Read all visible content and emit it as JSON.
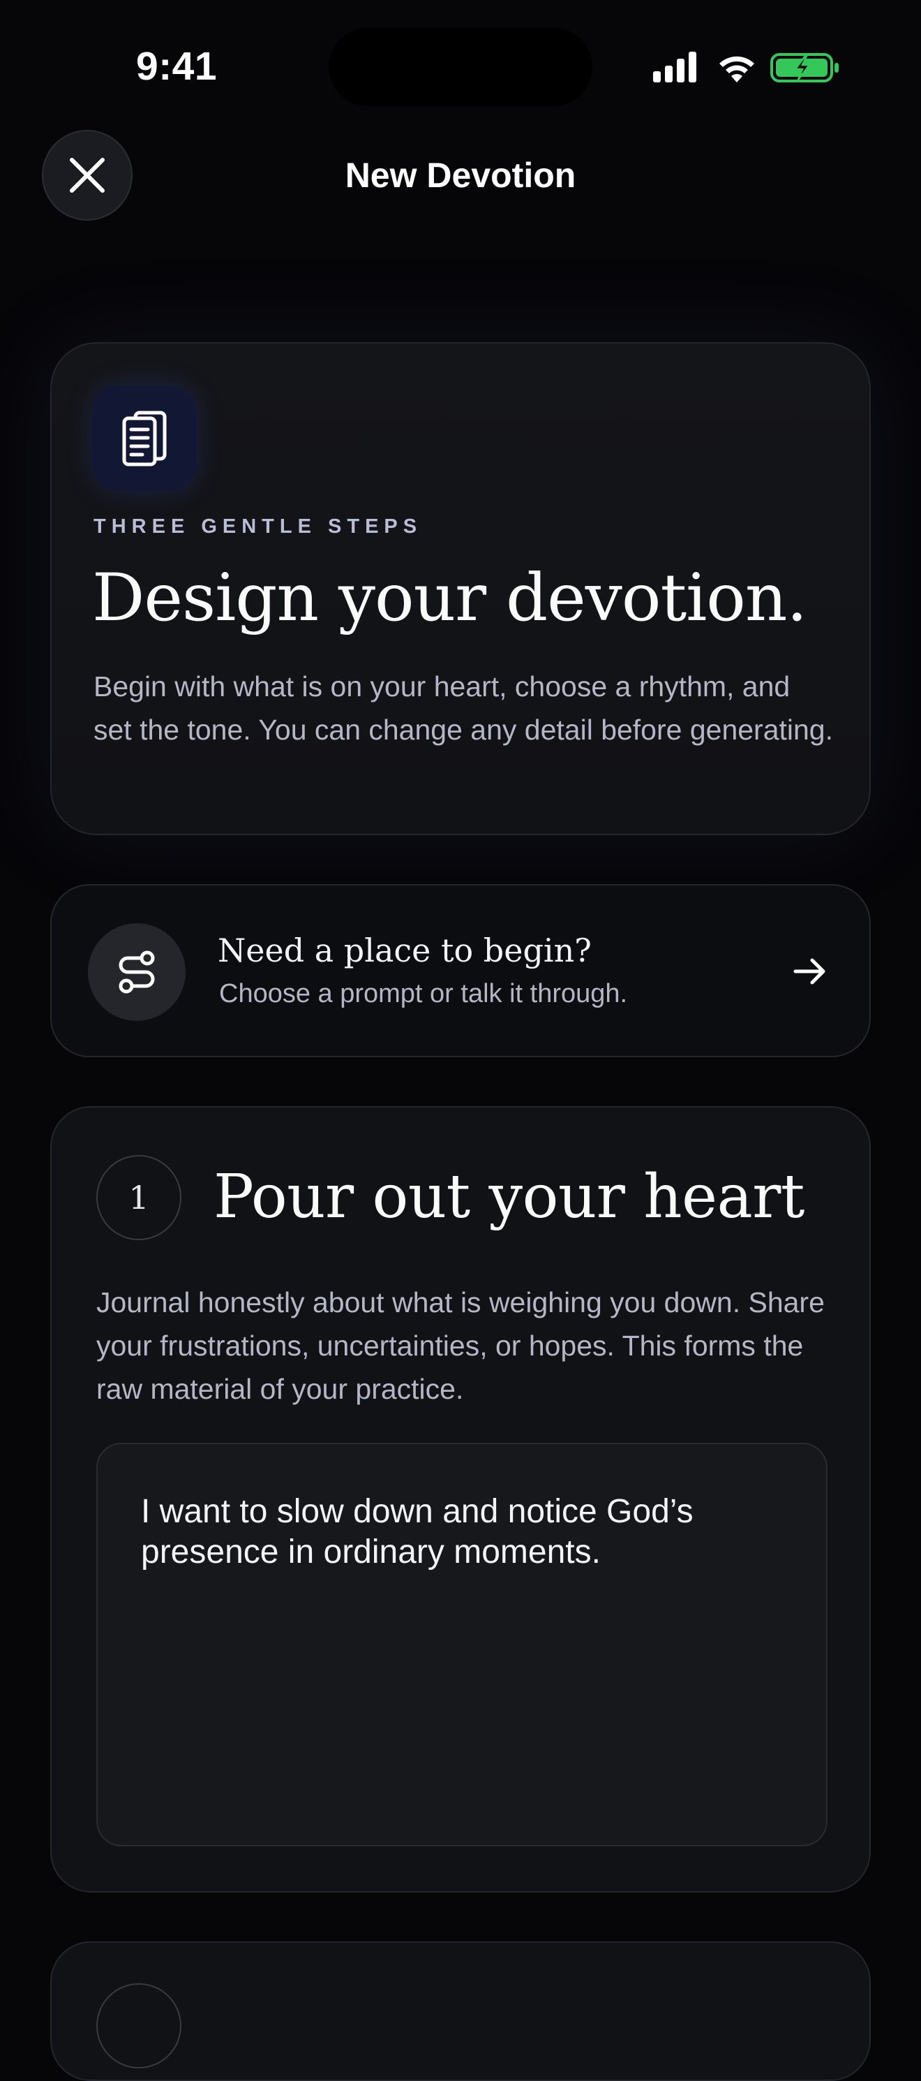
{
  "status_bar": {
    "time": "9:41",
    "icons": [
      "signal-icon",
      "wifi-icon",
      "battery-charging-icon"
    ],
    "battery_color": "#34c759"
  },
  "nav": {
    "title": "New Devotion",
    "close_icon": "close-icon"
  },
  "hero": {
    "icon": "document-icon",
    "eyebrow": "THREE GENTLE STEPS",
    "title": "Design your devotion.",
    "description": "Begin with what is on your heart, choose a rhythm, and set the tone. You can change any detail before generating."
  },
  "prompt_card": {
    "icon": "route-icon",
    "title": "Need a place to begin?",
    "subtitle": "Choose a prompt or talk it through.",
    "arrow_icon": "arrow-right-icon"
  },
  "step1": {
    "number": "1",
    "title": "Pour out your heart",
    "description": "Journal honestly about what is weighing you down. Share your frustrations, uncertainties, or hopes. This forms the raw material of your practice.",
    "input_value": "I want to slow down and notice God’s presence in ordinary moments."
  },
  "colors": {
    "background": "#060609",
    "card": "#111216",
    "accent_icon_bg": "#121833"
  }
}
